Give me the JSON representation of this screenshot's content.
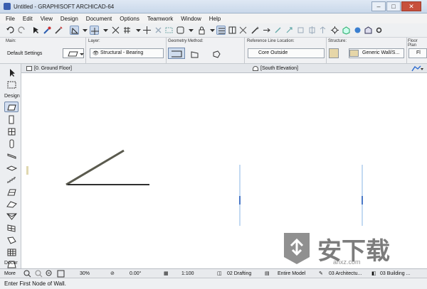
{
  "window": {
    "title": "Untitled - GRAPHISOFT ARCHICAD-64",
    "minimize": "–",
    "maximize": "□",
    "close": "✕"
  },
  "menu": [
    "File",
    "Edit",
    "View",
    "Design",
    "Document",
    "Options",
    "Teamwork",
    "Window",
    "Help"
  ],
  "infobox": {
    "main_label": "Main:",
    "main_value": "Default Settings",
    "layer_label": "Layer:",
    "layer_value": "Structural - Bearing",
    "geometry_label": "Geometry Method:",
    "refline_label": "Reference Line Location:",
    "refline_value": "Core Outside",
    "structure_label": "Structure:",
    "structure_value": "Generic Wall/S...",
    "floorplan_label": "Floor Plan",
    "floorplan_value": "Fl"
  },
  "tabs": {
    "plan": "[0. Ground Floor]",
    "elevation": "[South Elevation]"
  },
  "toolbox": {
    "design_label": "Design",
    "document_label": "Docur",
    "more_label": "More"
  },
  "navigator": {
    "zoom": "30%",
    "angle": "0.00°",
    "scale": "1:100",
    "layer_combo": "02 Drafting",
    "model_view": "Entire Model",
    "pen_set": "03 Architectu...",
    "dim_std": "03 Building ..."
  },
  "status": {
    "prompt": "Enter First Node of Wall."
  },
  "watermark": {
    "text": "安下载",
    "sub": "anxz.com"
  },
  "colors": {
    "wall_line": "#2f2f2f",
    "elevation_line": "#8ab4e6",
    "selected_tool_bg": "#d3def0",
    "accent": "#3a5fb0"
  }
}
